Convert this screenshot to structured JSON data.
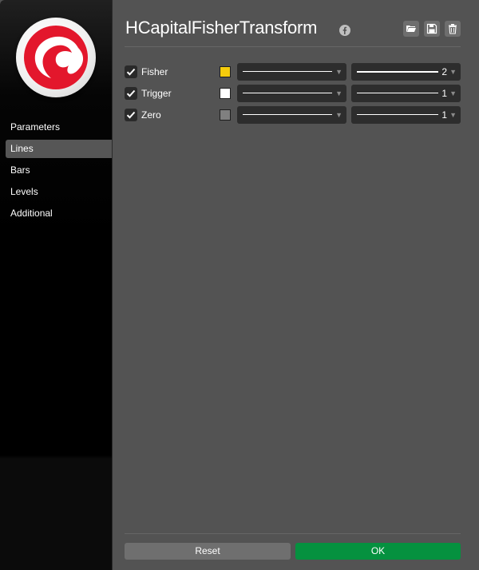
{
  "app": {
    "title": "HCapitalFisherTransform",
    "logo_icon": "cbrain-logo-icon",
    "info_icon": "facebook-icon"
  },
  "toolbar": {
    "open_icon": "folder-open-icon",
    "save_icon": "save-icon",
    "delete_icon": "trash-icon"
  },
  "sidebar": {
    "items": [
      {
        "label": "Parameters",
        "active": false
      },
      {
        "label": "Lines",
        "active": true
      },
      {
        "label": "Bars",
        "active": false
      },
      {
        "label": "Levels",
        "active": false
      },
      {
        "label": "Additional",
        "active": false
      }
    ]
  },
  "lines": [
    {
      "name": "Fisher",
      "checked": true,
      "color": "#f5cc0c",
      "style": "solid",
      "width": "2"
    },
    {
      "name": "Trigger",
      "checked": true,
      "color": "#ffffff",
      "style": "solid",
      "width": "1"
    },
    {
      "name": "Zero",
      "checked": true,
      "color": "#808080",
      "style": "solid",
      "width": "1"
    }
  ],
  "footer": {
    "reset_label": "Reset",
    "ok_label": "OK"
  },
  "colors": {
    "accent_ok": "#05913f",
    "panel": "#535353",
    "logo_red": "#e3172c"
  }
}
